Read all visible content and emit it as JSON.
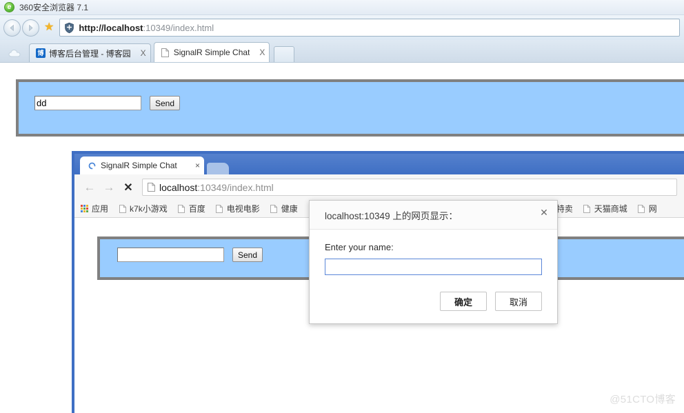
{
  "browser360": {
    "window_title": "360安全浏览器 7.1",
    "logo_glyph": "e",
    "nav": {
      "back_label": "◀",
      "forward_label": "▶",
      "star_label": "★"
    },
    "address": {
      "host": "http://localhost",
      "rest": ":10349/index.html"
    },
    "tabs": [
      {
        "label": "博客后台管理 - 博客园",
        "close": "X",
        "favicon": "博",
        "active": false
      },
      {
        "label": "SignalR Simple Chat",
        "close": "X",
        "favicon": "page-icon",
        "active": true
      }
    ],
    "page": {
      "input_value": "dd",
      "input_placeholder": "",
      "send_label": "Send"
    }
  },
  "chrome": {
    "tab": {
      "label": "SignalR Simple Chat",
      "close": "×"
    },
    "nav": {
      "back": "←",
      "forward": "→",
      "stop": "✕"
    },
    "address": {
      "host": "localhost",
      "rest": ":10349/index.html"
    },
    "bookmarks": [
      {
        "label": "应用",
        "icon": "apps-grid-icon"
      },
      {
        "label": "k7k小游戏",
        "icon": "page-icon"
      },
      {
        "label": "百度",
        "icon": "page-icon"
      },
      {
        "label": "电视电影",
        "icon": "page-icon"
      },
      {
        "label": "健康",
        "icon": "page-icon"
      },
      {
        "label": "淘宝特卖",
        "icon": "page-icon"
      },
      {
        "label": "天猫商城",
        "icon": "page-icon"
      },
      {
        "label": "网",
        "icon": "page-icon"
      }
    ],
    "page": {
      "input_value": "",
      "input_placeholder": "",
      "send_label": "Send"
    }
  },
  "dialog": {
    "title": "localhost:10349 上的网页显示：",
    "close_label": "✕",
    "prompt_label": "Enter your name:",
    "input_value": "",
    "input_placeholder": "",
    "confirm_label": "确定",
    "cancel_label": "取消"
  },
  "watermark": "@51CTO博客",
  "colors": {
    "chat_panel_bg": "#99ccff",
    "chat_panel_border": "#808080",
    "chrome_frame": "#3f6fc4",
    "dialog_input_border": "#5a86d8"
  }
}
